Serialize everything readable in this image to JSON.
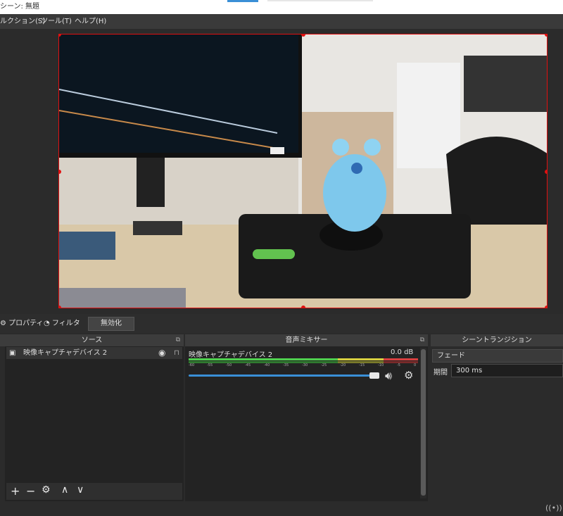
{
  "window": {
    "title": "シーン: 無題"
  },
  "menu": {
    "items": [
      "ルクション(S)",
      "ツール(T)",
      "ヘルプ(H)"
    ]
  },
  "toolbar": {
    "properties_label": "プロパティ",
    "filters_label": "フィルタ",
    "disable_label": "無効化"
  },
  "sources": {
    "title": "ソース",
    "items": [
      {
        "name": "映像キャプチャデバイス 2",
        "visible": true,
        "locked": false
      }
    ],
    "tools": {
      "add": "+",
      "remove": "−",
      "up": "∧",
      "down": "∨"
    }
  },
  "mixer": {
    "title": "音声ミキサー",
    "channel_name": "映像キャプチャデバイス 2",
    "level_db": "0.0 dB",
    "tick_labels": [
      "-60",
      "-55",
      "-50",
      "-45",
      "-40",
      "-35",
      "-30",
      "-25",
      "-20",
      "-15",
      "-10",
      "-5",
      "0"
    ],
    "volume": 1.0
  },
  "transitions": {
    "title": "シーントランジション",
    "selected": "フェード",
    "duration_label": "期間",
    "duration_value": "300 ms"
  },
  "colors": {
    "selection_red": "#e01010",
    "accent_blue": "#3a8fd6",
    "meter_green": "#4fd04f",
    "meter_yellow": "#d8d040",
    "meter_red": "#d84040"
  }
}
